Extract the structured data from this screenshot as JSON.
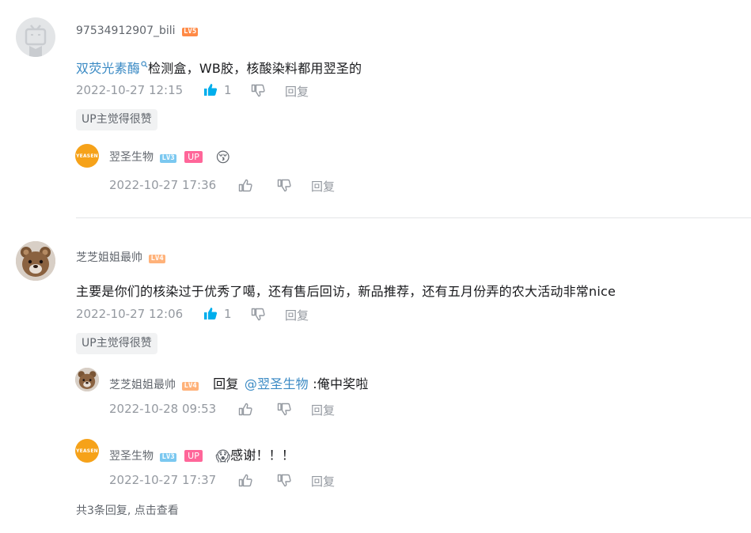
{
  "comments": [
    {
      "username": "97534912907_bili",
      "level": "LV5",
      "content_link": "双荧光素酶",
      "content_text": "检测盒，WB胶，核酸染料都用翌圣的",
      "time": "2022-10-27 12:15",
      "likes": "1",
      "reply_label": "回复",
      "up_tag": "UP主觉得很赞",
      "replies": [
        {
          "username": "翌圣生物",
          "level": "LV3",
          "up_badge": "UP",
          "content": "",
          "emoji": "😚",
          "time": "2022-10-27 17:36",
          "reply_label": "回复"
        }
      ]
    },
    {
      "username": "芝芝姐姐最帅",
      "level": "LV4",
      "content": "主要是你们的核染过于优秀了噶，还有售后回访，新品推荐，还有五月份弄的农大活动非常nice",
      "time": "2022-10-27 12:06",
      "likes": "1",
      "reply_label": "回复",
      "up_tag": "UP主觉得很赞",
      "replies": [
        {
          "username": "芝芝姐姐最帅",
          "level": "LV4",
          "reply_prefix": "回复",
          "mention": "@翌圣生物",
          "content": ":俺中奖啦",
          "time": "2022-10-28 09:53",
          "reply_label": "回复"
        },
        {
          "username": "翌圣生物",
          "level": "LV3",
          "up_badge": "UP",
          "emoji": "😱",
          "content": "感谢！！！",
          "time": "2022-10-27 17:37",
          "reply_label": "回复"
        }
      ],
      "more_replies": "共3条回复, 点击查看"
    }
  ],
  "avatar_logo_text": "YEASEN",
  "colors": {
    "link": "#3a8ac4",
    "like_active": "#00aeec",
    "up_badge": "#ff6699",
    "yeasen_orange": "#f6a219"
  }
}
